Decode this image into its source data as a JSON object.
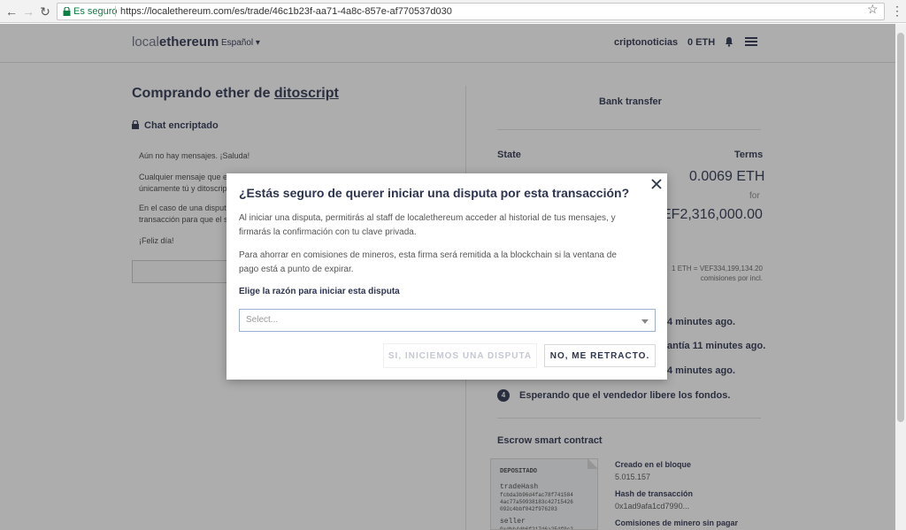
{
  "browser": {
    "secure_label": "Es seguro",
    "url": "https://localethereum.com/es/trade/46c1b23f-aa71-4a8c-857e-af770537d030"
  },
  "header": {
    "logo_light": "local",
    "logo_bold": "ethereum",
    "language": "Español ▾",
    "username": "criptonoticias",
    "balance": "0 ETH"
  },
  "left": {
    "title_prefix": "Comprando ether de ",
    "title_user": "ditoscript",
    "chat_title": "Chat encriptado",
    "messages": [
      "Aún no hay mensajes. ¡Saluda!",
      "Cualquier mensaje que e",
      "únicamente tú y ditoscrip",
      "En el caso de una disputa",
      "transacción para que el s",
      "¡Feliz día!"
    ]
  },
  "right": {
    "payment_method": "Bank transfer",
    "state_header": "State",
    "terms_header": "Terms",
    "amount_eth": "0.0069 ETH",
    "for_label": "for",
    "amount_vef": "EF2,316,000.00",
    "rate_line1": "1 ETH = VEF334,199,134.20",
    "rate_line2": "comisiones por incl.",
    "steps": [
      "4 minutes ago.",
      "antía 11 minutes ago.",
      "4 minutes ago.",
      "Esperando que el vendedor libere los fondos."
    ],
    "step4_number": "4",
    "escrow_title": "Escrow smart contract",
    "escrow_card": {
      "header": "DEPOSITADO",
      "field1": "tradeHash",
      "hash1": "fcbda3b96d4fac78f741584",
      "hash2": "4ac77a50938183c42715426",
      "hash3": "092c4bbf042f976203",
      "field2": "seller",
      "seller_partial": "0xdbb4db6f217d6a254f9c2"
    },
    "created_label": "Creado en el bloque",
    "created_value": "5.015.157",
    "tx_label": "Hash de transacción",
    "tx_value": "0x1ad9afa1cd7990...",
    "fees_label": "Comisiones de minero sin pagar"
  },
  "modal": {
    "title": "¿Estás seguro de querer iniciar una disputa por esta transacción?",
    "para1_line1": "Al iniciar una disputa, permitirás al staff de localethereum acceder al historial de tus mensajes, y",
    "para1_line2": "firmarás la confirmación con tu clave privada.",
    "para2_line1": "Para ahorrar en comisiones de mineros, esta firma será remitida a la blockchain si la ventana de",
    "para2_line2": "pago está a punto de expirar.",
    "reason_label": "Elige la razón para iniciar esta disputa",
    "select_placeholder": "Select...",
    "confirm_label": "SI, INICIEMOS UNA DISPUTA",
    "cancel_label": "NO, ME RETRACTO."
  }
}
